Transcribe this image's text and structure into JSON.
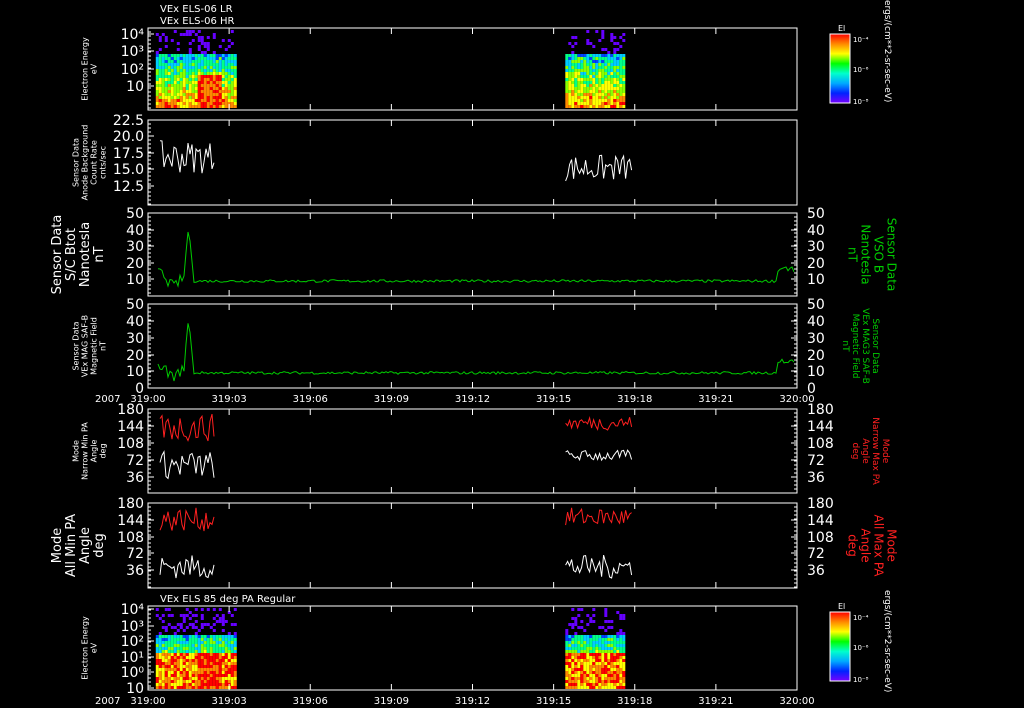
{
  "header": {
    "lines": [
      "VEx ELS-06 LR",
      "VEx ELS-06 HR"
    ]
  },
  "bottom_header": "VEx ELS 85 deg PA Regular",
  "colors": {
    "background": "#000000",
    "axes": "#ffffff",
    "green": "#00cc00",
    "red": "#ff2020",
    "white": "#ffffff"
  },
  "x_axis": {
    "year_label": "2007",
    "ticks": [
      "319:00",
      "319:03",
      "319:06",
      "319:09",
      "319:12",
      "319:15",
      "319:18",
      "319:21",
      "320:00"
    ]
  },
  "colorbars": [
    {
      "title": "El",
      "ticks": [
        "10⁻⁴",
        "10⁻⁶",
        "10⁻⁸"
      ],
      "unit": "ergs/(cm**2-sr-sec-eV)"
    },
    {
      "title": "El",
      "ticks": [
        "10⁻⁴",
        "10⁻⁶",
        "10⁻⁸"
      ],
      "unit": "ergs/(cm**2-sr-sec-eV)"
    }
  ],
  "chart_data": [
    {
      "type": "heatmap",
      "ylabel": [
        "Electron Energy",
        "eV"
      ],
      "yticks": [
        "10⁴",
        "10³",
        "10²",
        "10"
      ],
      "y_log": true,
      "data_windows": [
        [
          "319:00",
          "319:03"
        ],
        [
          "319:15",
          "319:17:30"
        ]
      ]
    },
    {
      "type": "line",
      "ylabel": [
        "Sensor Data",
        "Anode Background",
        "Count Rate",
        "cnts/sec"
      ],
      "yticks": [
        "22.5",
        "20.0",
        "17.5",
        "15.0",
        "12.5"
      ],
      "ylim": [
        11,
        22.5
      ],
      "series": [
        {
          "color": "white",
          "segments": [
            {
              "x0": 0.0,
              "x1": 0.0833,
              "mean": 17.5,
              "amp": 2.2
            },
            {
              "x0": 0.625,
              "x1": 0.729,
              "mean": 16.0,
              "amp": 1.8
            }
          ]
        }
      ]
    },
    {
      "type": "line",
      "ylabel": [
        "Sensor Data",
        "S/C Btot",
        "Nanotesla",
        "nT"
      ],
      "ylabel_right": [
        "Sensor Data",
        "VSO B",
        "Nanotesla",
        "nT"
      ],
      "yticks": [
        "50",
        "40",
        "30",
        "20",
        "10"
      ],
      "ylim": [
        0,
        50
      ],
      "series": [
        {
          "color": "green",
          "baseline": 9,
          "peak_x": 0.0625,
          "peak_y": 42,
          "end_y": 16
        }
      ]
    },
    {
      "type": "line",
      "ylabel": [
        "Sensor Data",
        "VEx MAG SAF-B",
        "Magnetic Field",
        "nT"
      ],
      "ylabel_right": [
        "Sensor Data",
        "VEx MAG3 SAF-B",
        "Magnetic Field",
        "nT"
      ],
      "yticks": [
        "50",
        "40",
        "30",
        "20",
        "10",
        "0"
      ],
      "ylim": [
        0,
        50
      ],
      "series": [
        {
          "color": "green",
          "baseline": 9,
          "peak_x": 0.0625,
          "peak_y": 42,
          "end_y": 16
        }
      ]
    },
    {
      "type": "line",
      "ylabel": [
        "Mode",
        "Narrow Min PA",
        "Angle",
        "deg"
      ],
      "ylabel_right": [
        "Mode",
        "Narrow Max PA",
        "Angle",
        "deg"
      ],
      "yticks": [
        "180",
        "144",
        "108",
        "72",
        "36"
      ],
      "ylim": [
        0,
        180
      ],
      "series": [
        {
          "name": "Min",
          "color": "white",
          "segments": [
            {
              "x0": 0.0,
              "x1": 0.0833,
              "mean": 60,
              "amp": 30
            },
            {
              "x0": 0.625,
              "x1": 0.729,
              "mean": 80,
              "amp": 12
            }
          ]
        },
        {
          "name": "Max",
          "color": "red",
          "segments": [
            {
              "x0": 0.0,
              "x1": 0.0833,
              "mean": 140,
              "amp": 30
            },
            {
              "x0": 0.625,
              "x1": 0.729,
              "mean": 150,
              "amp": 15
            }
          ]
        }
      ]
    },
    {
      "type": "line",
      "ylabel": [
        "Mode",
        "All Min PA",
        "Angle",
        "deg"
      ],
      "ylabel_right": [
        "Mode",
        "All Max PA",
        "Angle",
        "deg"
      ],
      "yticks": [
        "180",
        "144",
        "108",
        "72",
        "36"
      ],
      "ylim": [
        0,
        180
      ],
      "series": [
        {
          "name": "Min",
          "color": "white",
          "segments": [
            {
              "x0": 0.0,
              "x1": 0.0833,
              "mean": 45,
              "amp": 25
            },
            {
              "x0": 0.625,
              "x1": 0.729,
              "mean": 45,
              "amp": 25
            }
          ]
        },
        {
          "name": "Max",
          "color": "red",
          "segments": [
            {
              "x0": 0.0,
              "x1": 0.0833,
              "mean": 145,
              "amp": 25
            },
            {
              "x0": 0.625,
              "x1": 0.729,
              "mean": 150,
              "amp": 20
            }
          ]
        }
      ]
    },
    {
      "type": "heatmap",
      "ylabel": [
        "Electron Energy",
        "eV"
      ],
      "yticks": [
        "10⁴",
        "10³",
        "10²",
        "10¹",
        "10⁰",
        "10"
      ],
      "y_log": true,
      "data_windows": [
        [
          "319:00",
          "319:03"
        ],
        [
          "319:15",
          "319:17:30"
        ]
      ]
    }
  ]
}
